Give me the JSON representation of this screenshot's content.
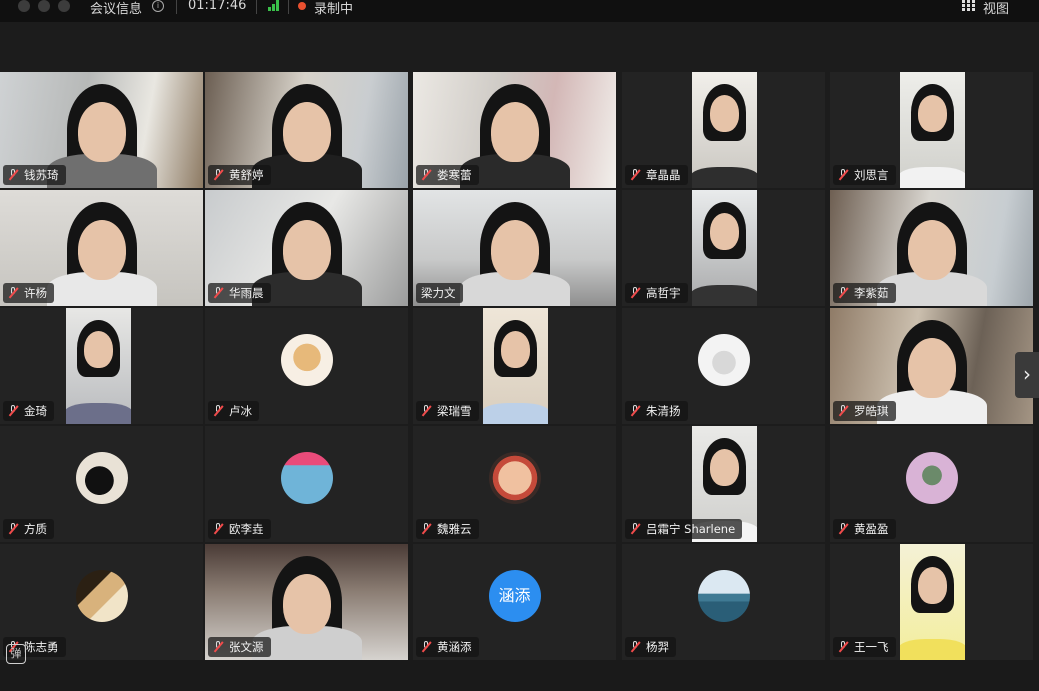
{
  "titlebar": {
    "meeting_info": "会议信息",
    "info_icon_glyph": "i",
    "elapsed_time": "01:17:46",
    "recording_label": "录制中",
    "view_label": "视图"
  },
  "colors": {
    "recording_dot": "#e9502f",
    "signal": "#3ac04a",
    "muted_mic": "#f04b4b",
    "avatar_text_bg": "#2c8ef0"
  },
  "participants": [
    {
      "name": "钱苏琦",
      "muted": true,
      "kind": "video"
    },
    {
      "name": "黄舒婷",
      "muted": true,
      "kind": "video"
    },
    {
      "name": "娄寒蕾",
      "muted": true,
      "kind": "video"
    },
    {
      "name": "章晶晶",
      "muted": true,
      "kind": "video"
    },
    {
      "name": "刘思言",
      "muted": true,
      "kind": "video"
    },
    {
      "name": "许杨",
      "muted": true,
      "kind": "video"
    },
    {
      "name": "华雨晨",
      "muted": true,
      "kind": "video"
    },
    {
      "name": "梁力文",
      "muted": false,
      "kind": "video"
    },
    {
      "name": "高哲宇",
      "muted": true,
      "kind": "video"
    },
    {
      "name": "李紫茹",
      "muted": true,
      "kind": "video"
    },
    {
      "name": "金琦",
      "muted": true,
      "kind": "video"
    },
    {
      "name": "卢冰",
      "muted": true,
      "kind": "avatar"
    },
    {
      "name": "梁瑞雪",
      "muted": true,
      "kind": "video"
    },
    {
      "name": "朱清扬",
      "muted": true,
      "kind": "avatar"
    },
    {
      "name": "罗皓琪",
      "muted": true,
      "kind": "video"
    },
    {
      "name": "方质",
      "muted": true,
      "kind": "avatar"
    },
    {
      "name": "欧李垚",
      "muted": true,
      "kind": "avatar"
    },
    {
      "name": "魏雅云",
      "muted": true,
      "kind": "avatar"
    },
    {
      "name": "吕霜宁 Sharlene",
      "muted": true,
      "kind": "video"
    },
    {
      "name": "黄盈盈",
      "muted": true,
      "kind": "avatar"
    },
    {
      "name": "陈志勇",
      "muted": true,
      "kind": "avatar"
    },
    {
      "name": "张文源",
      "muted": true,
      "kind": "video"
    },
    {
      "name": "黄涵添",
      "muted": true,
      "kind": "avatar-text",
      "avatar_text": "涵添"
    },
    {
      "name": "杨羿",
      "muted": true,
      "kind": "avatar"
    },
    {
      "name": "王一飞",
      "muted": true,
      "kind": "video"
    }
  ],
  "icons": {
    "window_controls": [
      "close-dot",
      "minimize-dot",
      "zoom-dot"
    ],
    "view_icon": "grid-icon",
    "next_page": "chevron-right-icon",
    "danmu": "danmu-icon",
    "next_glyph": "›",
    "danmu_glyph": "弹"
  }
}
